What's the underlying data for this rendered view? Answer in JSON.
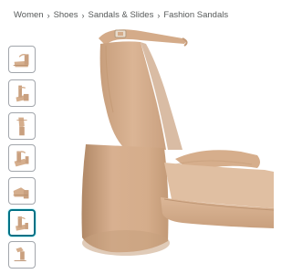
{
  "breadcrumb": {
    "items": [
      "Women",
      "Shoes",
      "Sandals & Slides",
      "Fashion Sandals"
    ],
    "separator": "›"
  },
  "gallery": {
    "thumbnail_count": 7,
    "selected_index": 5,
    "product_color": "#d5ae8d",
    "accent_color": "#007185"
  }
}
